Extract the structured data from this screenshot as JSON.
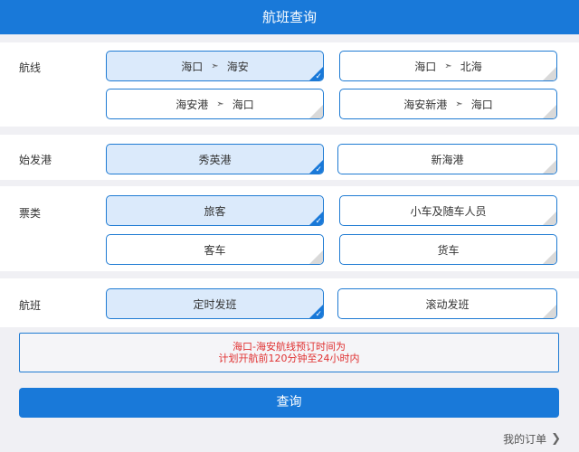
{
  "header": {
    "title": "航班查询"
  },
  "route": {
    "label": "航线",
    "options": [
      {
        "from": "海口",
        "to": "海安",
        "selected": true
      },
      {
        "from": "海口",
        "to": "北海",
        "selected": false
      },
      {
        "from": "海安港",
        "to": "海口",
        "selected": false
      },
      {
        "from": "海安新港",
        "to": "海口",
        "selected": false
      }
    ]
  },
  "departure_port": {
    "label": "始发港",
    "options": [
      {
        "label": "秀英港",
        "selected": true
      },
      {
        "label": "新海港",
        "selected": false
      }
    ]
  },
  "ticket_type": {
    "label": "票类",
    "options": [
      {
        "label": "旅客",
        "selected": true
      },
      {
        "label": "小车及随车人员",
        "selected": false
      },
      {
        "label": "客车",
        "selected": false
      },
      {
        "label": "货车",
        "selected": false
      }
    ]
  },
  "sailing": {
    "label": "航班",
    "options": [
      {
        "label": "定时发班",
        "selected": true
      },
      {
        "label": "滚动发班",
        "selected": false
      }
    ]
  },
  "notice": {
    "line1": "海口-海安航线预订时间为",
    "line2": "计划开航前120分钟至24小时内"
  },
  "query_button": {
    "label": "查询"
  },
  "my_orders": {
    "label": "我的订单"
  },
  "icons": {
    "route_arrow": "route-arrow-icon",
    "check": "check-icon",
    "chevron": "chevron-right-icon"
  },
  "colors": {
    "primary": "#1979d9",
    "selected_bg": "#dbeafb",
    "notice_text": "#e03030"
  }
}
